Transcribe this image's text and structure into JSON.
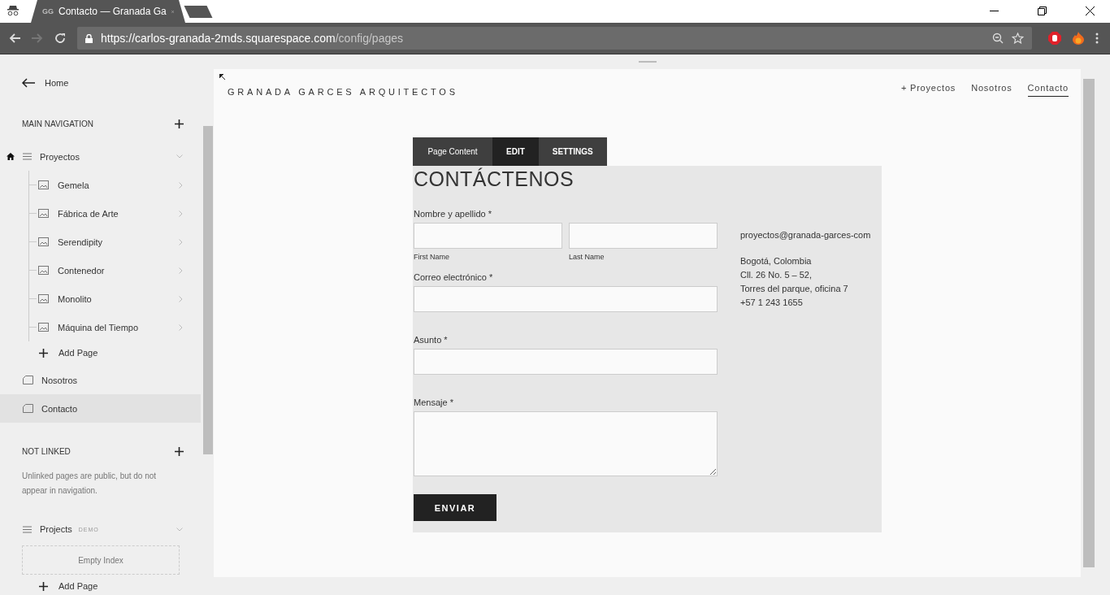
{
  "browser": {
    "tab": {
      "favicon": "GG",
      "title": "Contacto — Granada Ga"
    },
    "url": {
      "host": "https://carlos-granada-2mds.squarespace.com",
      "path": "/config/pages"
    }
  },
  "sidebar": {
    "back": "Home",
    "main_navigation": {
      "title": "MAIN NAVIGATION",
      "items": [
        {
          "label": "Proyectos",
          "kind": "folder",
          "home": true,
          "selected": false,
          "children": [
            {
              "label": "Gemela",
              "kind": "gallery"
            },
            {
              "label": "Fábrica de Arte",
              "kind": "gallery"
            },
            {
              "label": "Serendipity",
              "kind": "gallery"
            },
            {
              "label": "Contenedor",
              "kind": "gallery"
            },
            {
              "label": "Monolito",
              "kind": "gallery"
            },
            {
              "label": "Máquina del Tiempo",
              "kind": "gallery"
            }
          ],
          "add_page": "Add Page"
        },
        {
          "label": "Nosotros",
          "kind": "page",
          "home": false,
          "selected": false
        },
        {
          "label": "Contacto",
          "kind": "page",
          "home": false,
          "selected": true
        }
      ]
    },
    "not_linked": {
      "title": "NOT LINKED",
      "description": "Unlinked pages are public, but do not appear in navigation.",
      "items": [
        {
          "label": "Projects",
          "badge": "DEMO",
          "kind": "folder",
          "empty": "Empty Index",
          "add_page": "Add Page"
        }
      ]
    }
  },
  "site": {
    "logo": "GRANADA GARCES ARQUITECTOS",
    "nav": [
      {
        "label": "+ Proyectos",
        "selected": false
      },
      {
        "label": "Nosotros",
        "selected": false
      },
      {
        "label": "Contacto",
        "selected": true
      }
    ]
  },
  "editor_tabs": [
    {
      "label": "Page Content",
      "selected": false
    },
    {
      "label": "EDIT",
      "selected": true
    },
    {
      "label": "SETTINGS",
      "selected": false
    }
  ],
  "form": {
    "heading": "CONTÁCTENOS",
    "fields": [
      {
        "kind": "name",
        "label": "Nombre y apellido *",
        "sublabels": [
          "First Name",
          "Last Name"
        ]
      },
      {
        "kind": "text",
        "label": "Correo electrónico *"
      },
      {
        "kind": "text",
        "label": "Asunto *"
      },
      {
        "kind": "textarea",
        "label": "Mensaje *"
      }
    ],
    "submit": "ENVIAR"
  },
  "contact": {
    "email": "proyectos@granada-garces-com",
    "address": [
      "Bogotá, Colombia",
      "Cll. 26 No. 5 – 52,",
      "Torres del parque, oficina 7",
      "+57 1 243 1655"
    ]
  }
}
